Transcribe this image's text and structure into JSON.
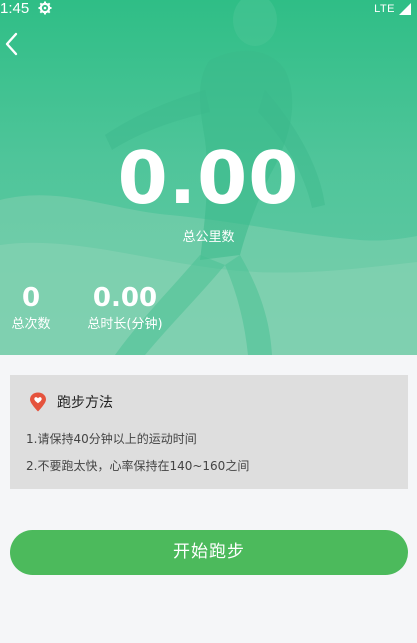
{
  "status_bar": {
    "time": "1:45",
    "network": "LTE",
    "icons": [
      "gear-icon",
      "signal-icon"
    ]
  },
  "hero": {
    "back_icon": "back-arrow-icon",
    "total_distance_value": "0.00",
    "total_distance_label": "总公里数",
    "stats": [
      {
        "value": "0",
        "label": "总次数"
      },
      {
        "value": "0.00",
        "label": "总时长(分钟)"
      }
    ]
  },
  "method": {
    "icon": "location-heart-icon",
    "title": "跑步方法",
    "tips": [
      "1.请保持40分钟以上的运动时间",
      "2.不要跑太快，心率保持在140~160之间"
    ]
  },
  "start_button": {
    "label": "开始跑步"
  },
  "colors": {
    "hero_green": "#3fc08e",
    "button_green": "#4cba5c",
    "card_gray": "#dedede",
    "pin_red": "#e5533d"
  }
}
